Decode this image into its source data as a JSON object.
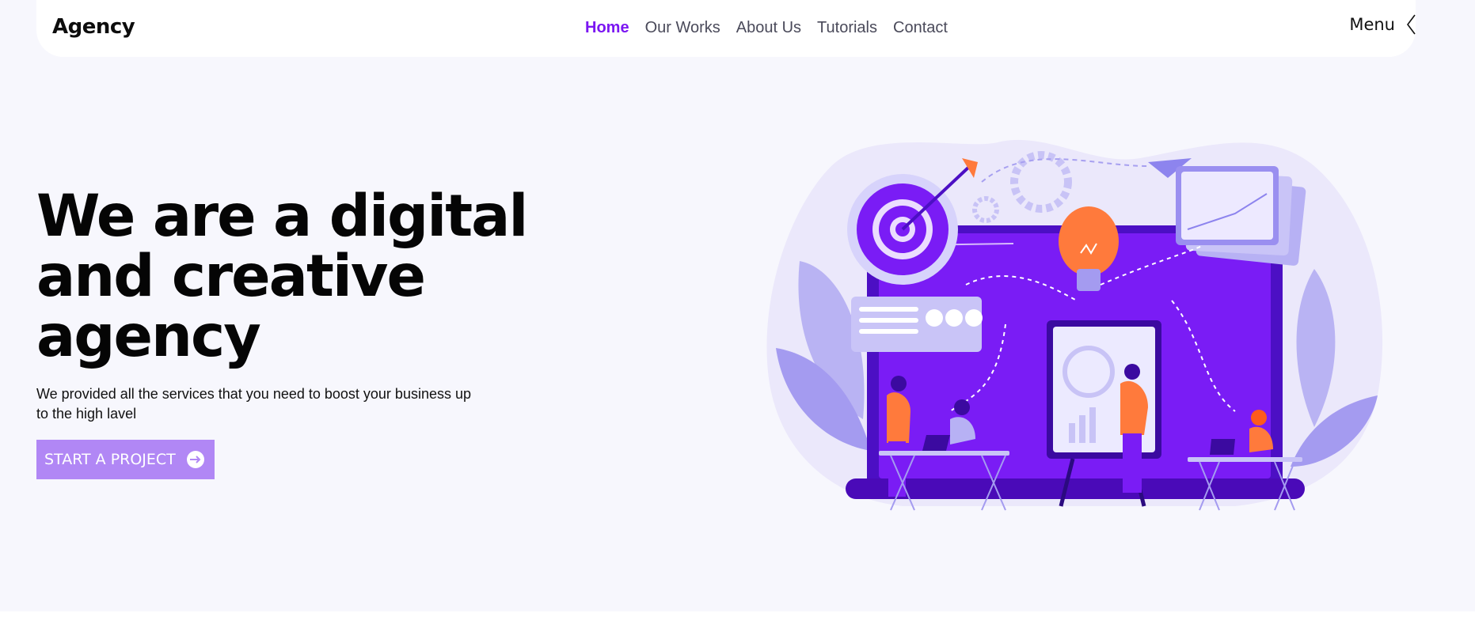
{
  "nav": {
    "brand": "Agency",
    "links": [
      {
        "label": "Home",
        "active": true
      },
      {
        "label": "Our Works",
        "active": false
      },
      {
        "label": "About Us",
        "active": false
      },
      {
        "label": "Tutorials",
        "active": false
      },
      {
        "label": "Contact",
        "active": false
      }
    ],
    "menu_label": "Menu",
    "menu_icon": "chevron-left-icon"
  },
  "hero": {
    "title_lines": [
      "We are a digital",
      "and creative",
      "agency"
    ],
    "subtitle": "We provided all the services that you need to boost your business up to the high lavel",
    "cta_label": "START A PROJECT",
    "cta_icon": "arrow-right-circle-icon"
  },
  "colors": {
    "accent": "#7b16f2",
    "cta_bg": "#b187f5",
    "hero_bg": "#f7f7fd"
  }
}
